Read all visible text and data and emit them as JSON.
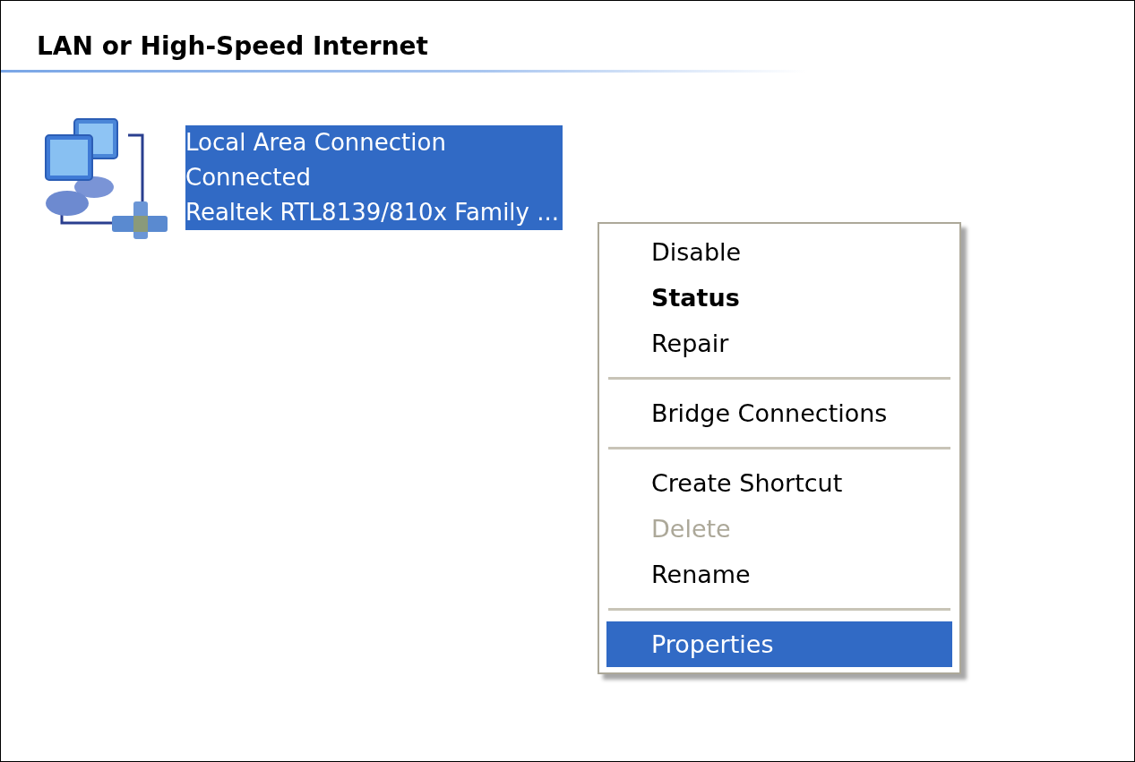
{
  "section": {
    "title": "LAN or High-Speed Internet"
  },
  "connection": {
    "name": "Local Area Connection",
    "status": "Connected",
    "device": "Realtek RTL8139/810x Family ...",
    "selected": true
  },
  "context_menu": [
    {
      "kind": "item",
      "label": "Disable",
      "default": false,
      "disabled": false,
      "selected": false
    },
    {
      "kind": "item",
      "label": "Status",
      "default": true,
      "disabled": false,
      "selected": false
    },
    {
      "kind": "item",
      "label": "Repair",
      "default": false,
      "disabled": false,
      "selected": false
    },
    {
      "kind": "separator"
    },
    {
      "kind": "item",
      "label": "Bridge Connections",
      "default": false,
      "disabled": false,
      "selected": false
    },
    {
      "kind": "separator"
    },
    {
      "kind": "item",
      "label": "Create Shortcut",
      "default": false,
      "disabled": false,
      "selected": false
    },
    {
      "kind": "item",
      "label": "Delete",
      "default": false,
      "disabled": true,
      "selected": false
    },
    {
      "kind": "item",
      "label": "Rename",
      "default": false,
      "disabled": false,
      "selected": false
    },
    {
      "kind": "separator"
    },
    {
      "kind": "item",
      "label": "Properties",
      "default": false,
      "disabled": false,
      "selected": true
    }
  ]
}
